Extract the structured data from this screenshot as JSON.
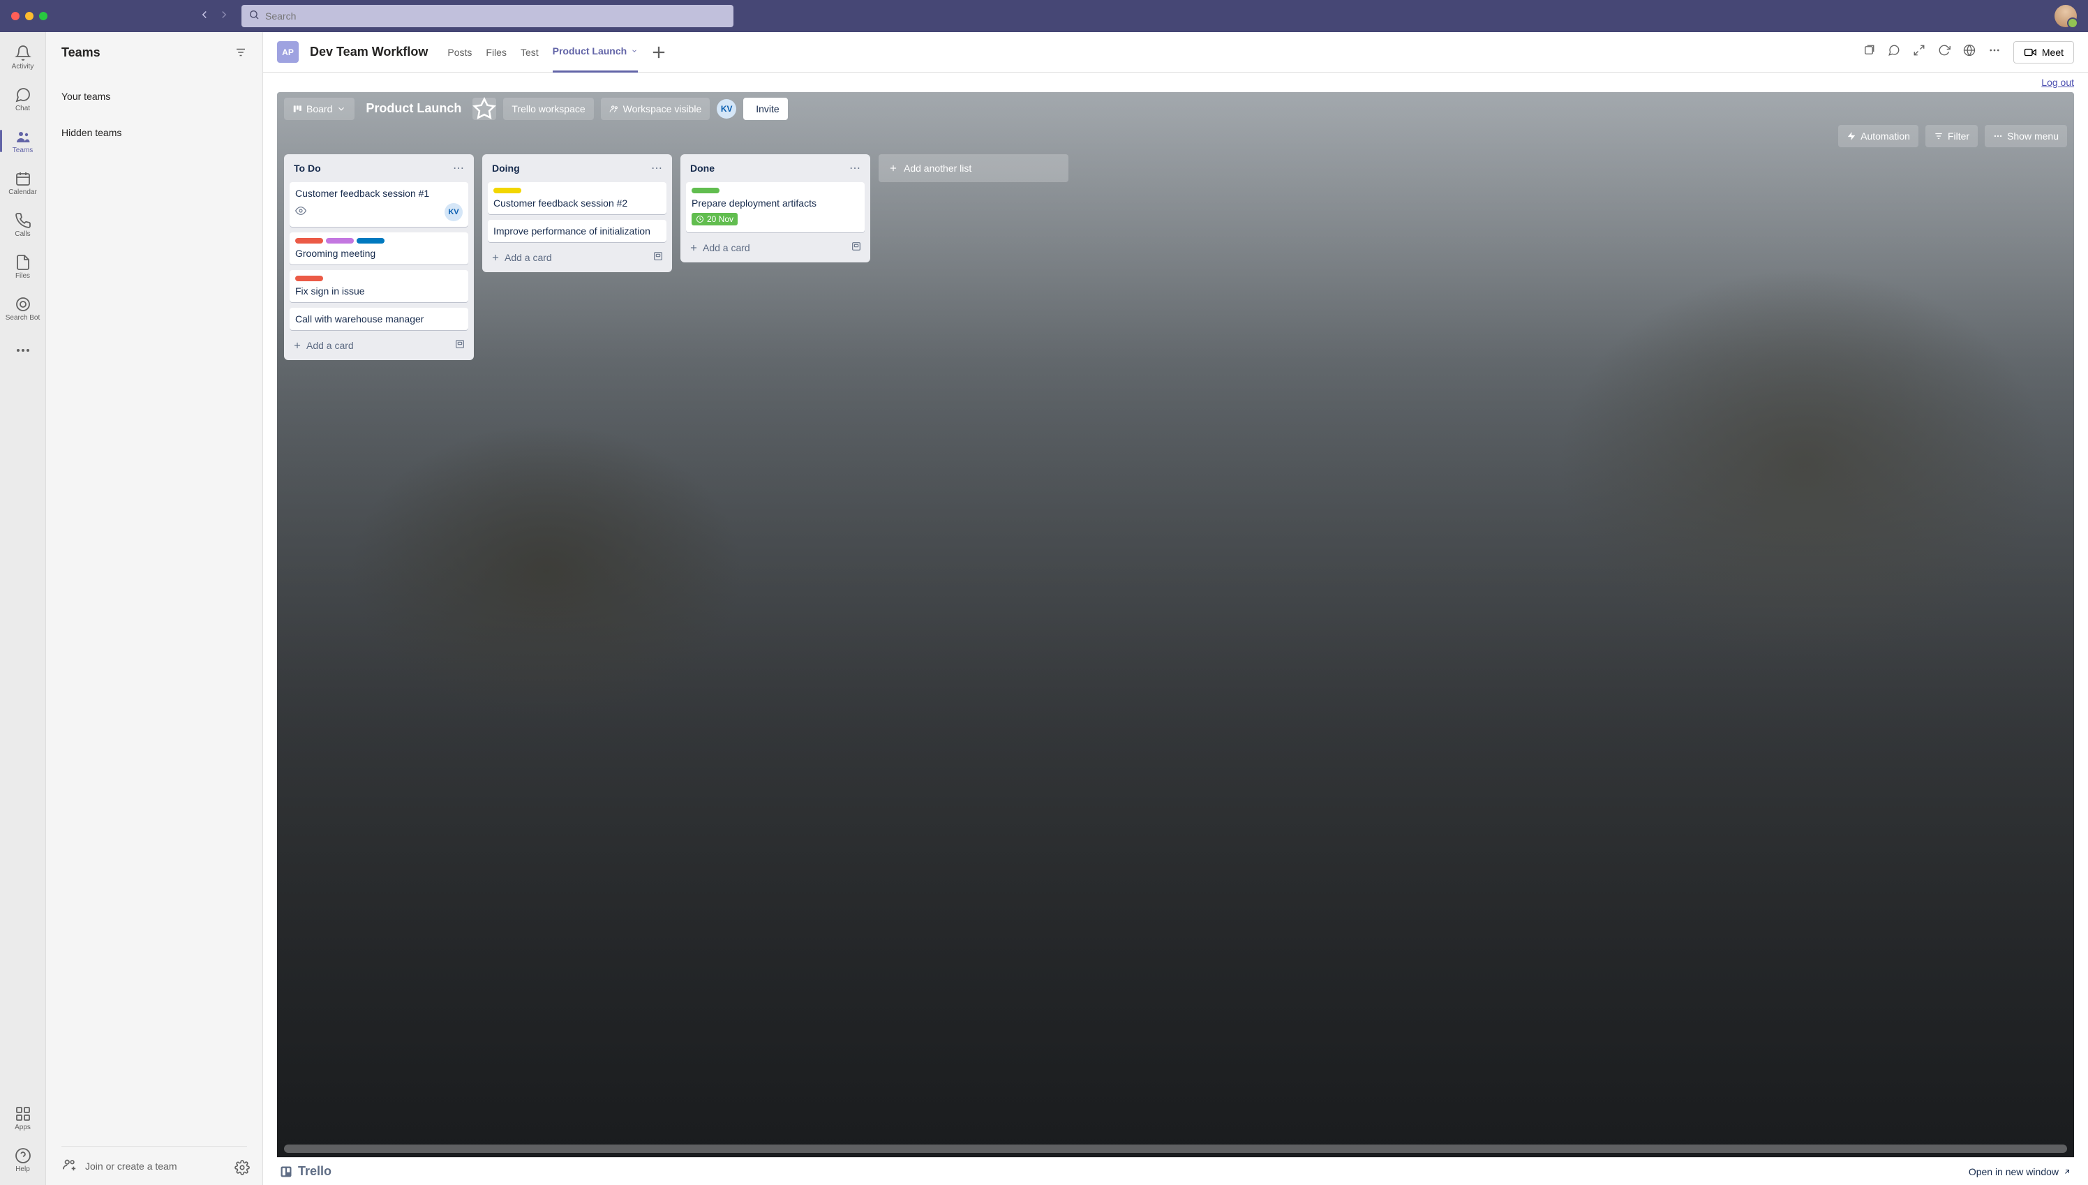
{
  "titlebar": {
    "search_placeholder": "Search"
  },
  "leftrail": {
    "activity": "Activity",
    "chat": "Chat",
    "teams": "Teams",
    "calendar": "Calendar",
    "calls": "Calls",
    "files": "Files",
    "searchbot": "Search Bot",
    "apps": "Apps",
    "help": "Help"
  },
  "teamspanel": {
    "title": "Teams",
    "your_teams": "Your teams",
    "hidden_teams": "Hidden teams",
    "join": "Join or create a team"
  },
  "chead": {
    "chip": "AP",
    "channel": "Dev Team Workflow",
    "tabs": {
      "posts": "Posts",
      "files": "Files",
      "test": "Test",
      "launch": "Product Launch"
    },
    "meet": "Meet"
  },
  "trello": {
    "logout": "Log out",
    "board_btn": "Board",
    "board_name": "Product Launch",
    "workspace": "Trello workspace",
    "visibility": "Workspace visible",
    "member": "KV",
    "invite": "Invite",
    "automation": "Automation",
    "filter": "Filter",
    "show_menu": "Show menu",
    "add_card": "Add a card",
    "add_list": "Add another list",
    "footer_brand": "Trello",
    "open_window": "Open in new window",
    "lists": [
      {
        "name": "To Do",
        "cards": [
          {
            "title": "Customer feedback session #1",
            "watch": true,
            "member": "KV",
            "labels": []
          },
          {
            "title": "Grooming meeting",
            "labels": [
              "red",
              "purple",
              "blue"
            ]
          },
          {
            "title": "Fix sign in issue",
            "labels": [
              "red"
            ]
          },
          {
            "title": "Call with warehouse manager",
            "labels": []
          }
        ]
      },
      {
        "name": "Doing",
        "cards": [
          {
            "title": "Customer feedback session #2",
            "labels": [
              "yellow"
            ]
          },
          {
            "title": "Improve performance of initialization",
            "labels": []
          }
        ]
      },
      {
        "name": "Done",
        "cards": [
          {
            "title": "Prepare deployment artifacts",
            "labels": [
              "green"
            ],
            "due": "20 Nov"
          }
        ]
      }
    ]
  }
}
